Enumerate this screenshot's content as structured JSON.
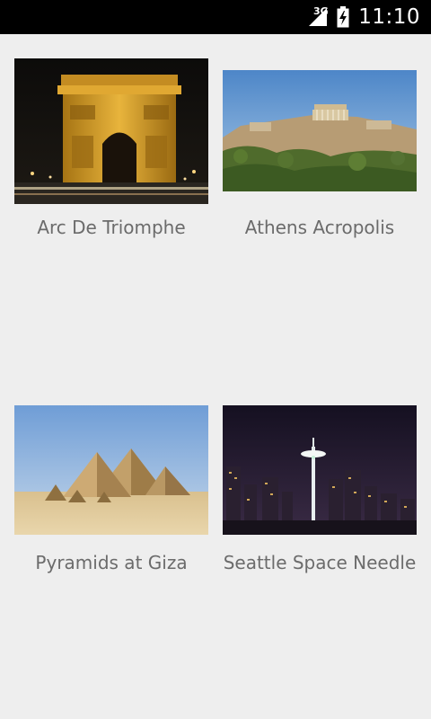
{
  "status_bar": {
    "network": "3G",
    "time": "11:10"
  },
  "grid": {
    "items": [
      {
        "title": "Arc De Triomphe",
        "image": "arc-de-triomphe-photo"
      },
      {
        "title": "Athens Acropolis",
        "image": "athens-acropolis-photo"
      },
      {
        "title": "Pyramids at Giza",
        "image": "pyramids-at-giza-photo"
      },
      {
        "title": "Seattle Space Needle",
        "image": "seattle-space-needle-photo"
      }
    ]
  },
  "colors": {
    "status_bar_bg": "#000000",
    "page_bg": "#eeeeee",
    "caption_text": "#6b6b6b"
  }
}
